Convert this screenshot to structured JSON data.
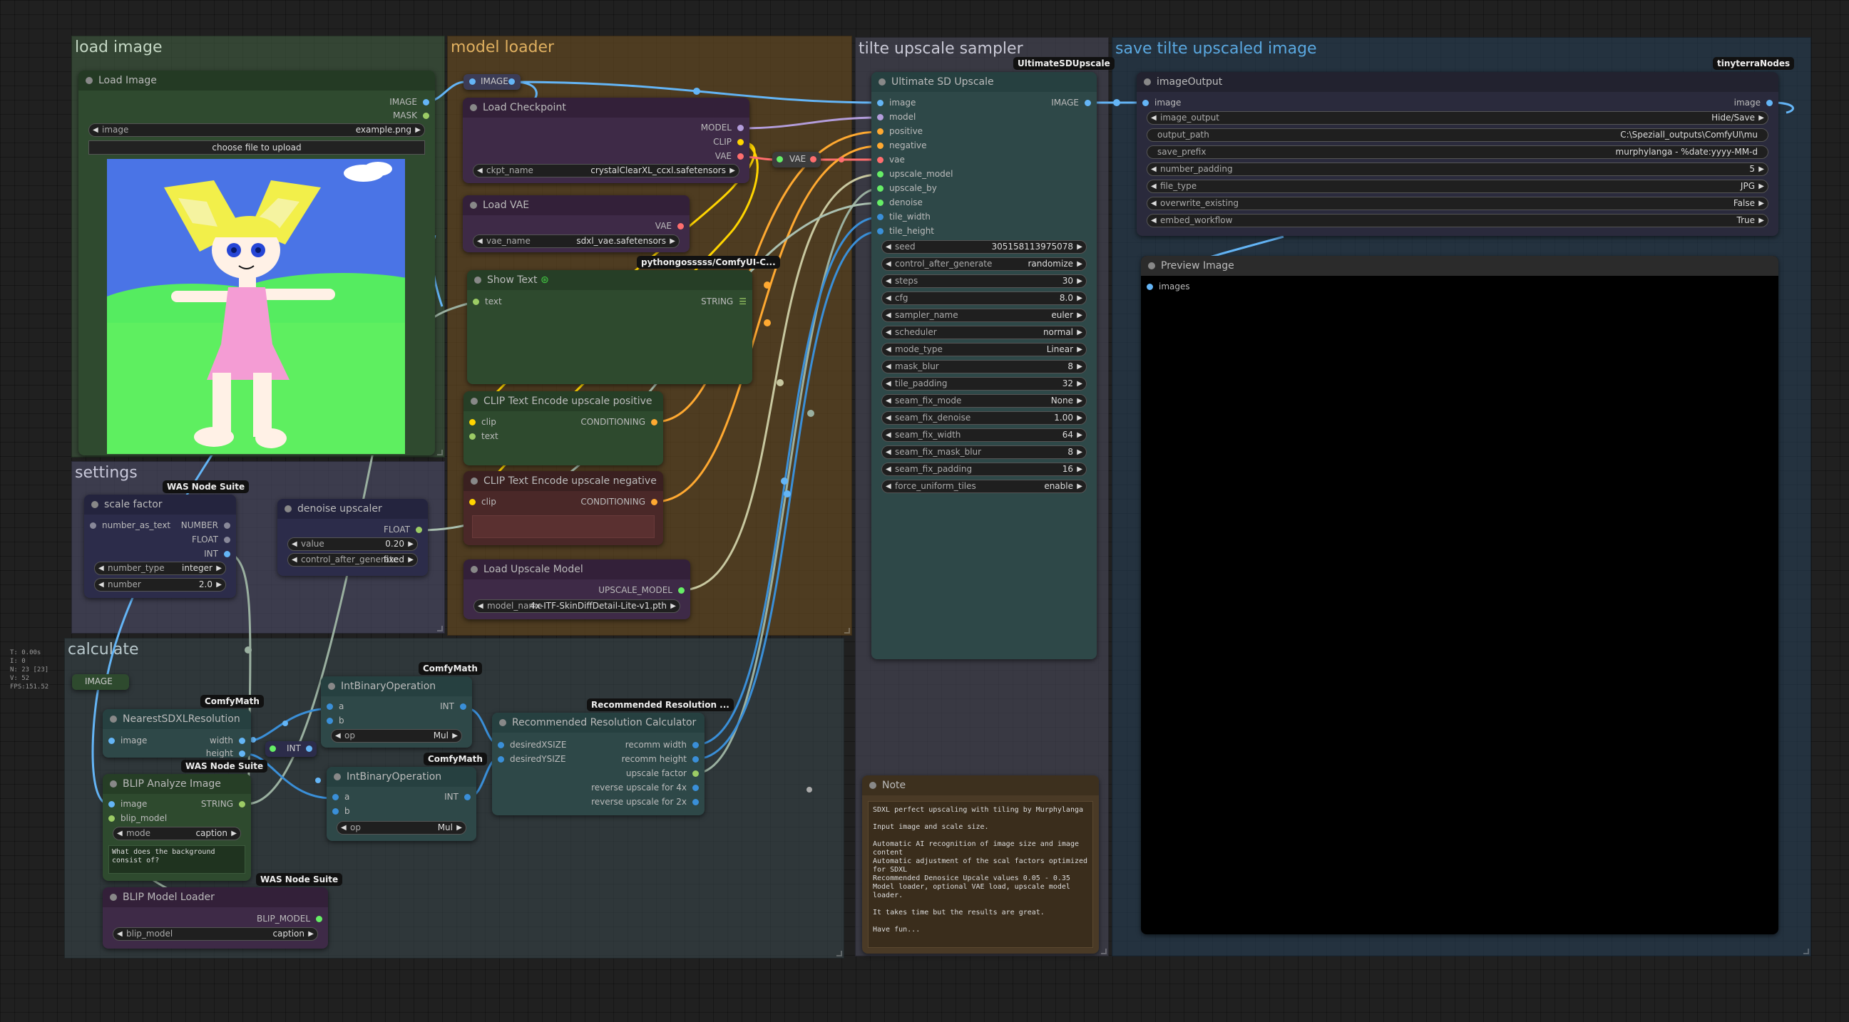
{
  "colors": {
    "accent": "#5ab0f0",
    "image_link": "#64b5f6",
    "model_link": "#b39ddb",
    "clip_link": "#ffd500",
    "vae_link": "#ff6e6e",
    "conditioning_link": "#ffa931",
    "upscale_model_link": "#c8c8a0"
  },
  "groups": {
    "load_image": "load image",
    "model_loader": "model loader",
    "tilte_upscale_sampler": "tilte upscale sampler",
    "save_tilte": "save tilte upscaled image",
    "settings": "settings",
    "calculate": "calculate"
  },
  "stats": {
    "t": "T: 0.00s",
    "i": "I: 0",
    "n": "N: 23 [23]",
    "v": "V: 52",
    "fps": "FPS:151.52"
  },
  "load_image": {
    "title": "Load Image",
    "out_image": "IMAGE",
    "out_mask": "MASK",
    "image_label": "image",
    "image_value": "example.png",
    "upload": "choose file to upload"
  },
  "reroute_image": {
    "label": "IMAGE"
  },
  "reroute_vae": {
    "label": "VAE"
  },
  "checkpoint": {
    "title": "Load Checkpoint",
    "out_model": "MODEL",
    "out_clip": "CLIP",
    "out_vae": "VAE",
    "ckpt_label": "ckpt_name",
    "ckpt_value": "crystalClearXL_ccxl.safetensors"
  },
  "load_vae": {
    "title": "Load VAE",
    "out_vae": "VAE",
    "vae_label": "vae_name",
    "vae_value": "sdxl_vae.safetensors"
  },
  "show_text": {
    "badge": "pythongosssss/ComfyUI-C...",
    "title": "Show Text",
    "in_text": "text",
    "out_string": "STRING"
  },
  "clip_pos": {
    "title": "CLIP Text Encode upscale positive",
    "in_clip": "clip",
    "in_text": "text",
    "out": "CONDITIONING"
  },
  "clip_neg": {
    "title": "CLIP Text Encode upscale negative",
    "in_clip": "clip",
    "out": "CONDITIONING"
  },
  "upscale_model": {
    "title": "Load Upscale Model",
    "out": "UPSCALE_MODEL",
    "model_label": "model_name",
    "model_value": "4x-ITF-SkinDiffDetail-Lite-v1.pth"
  },
  "usd": {
    "badge": "UltimateSDUpscale",
    "title": "Ultimate SD Upscale",
    "out": "IMAGE",
    "inputs": [
      "image",
      "model",
      "positive",
      "negative",
      "vae",
      "upscale_model",
      "upscale_by",
      "denoise",
      "tile_width",
      "tile_height"
    ],
    "widgets": [
      {
        "k": "seed",
        "v": "305158113975078"
      },
      {
        "k": "control_after_generate",
        "v": "randomize"
      },
      {
        "k": "steps",
        "v": "30"
      },
      {
        "k": "cfg",
        "v": "8.0"
      },
      {
        "k": "sampler_name",
        "v": "euler"
      },
      {
        "k": "scheduler",
        "v": "normal"
      },
      {
        "k": "mode_type",
        "v": "Linear"
      },
      {
        "k": "mask_blur",
        "v": "8"
      },
      {
        "k": "tile_padding",
        "v": "32"
      },
      {
        "k": "seam_fix_mode",
        "v": "None"
      },
      {
        "k": "seam_fix_denoise",
        "v": "1.00"
      },
      {
        "k": "seam_fix_width",
        "v": "64"
      },
      {
        "k": "seam_fix_mask_blur",
        "v": "8"
      },
      {
        "k": "seam_fix_padding",
        "v": "16"
      },
      {
        "k": "force_uniform_tiles",
        "v": "enable"
      }
    ]
  },
  "image_output": {
    "badge": "tinyterraNodes",
    "title": "imageOutput",
    "in_image": "image",
    "out_image": "image",
    "widgets": [
      {
        "k": "image_output",
        "v": "Hide/Save"
      },
      {
        "k": "output_path",
        "v": "C:\\Speziall_outputs\\ComfyUI\\mu"
      },
      {
        "k": "save_prefix",
        "v": "murphylanga - %date:yyyy-MM-d"
      },
      {
        "k": "number_padding",
        "v": "5"
      },
      {
        "k": "file_type",
        "v": "JPG"
      },
      {
        "k": "overwrite_existing",
        "v": "False"
      },
      {
        "k": "embed_workflow",
        "v": "True"
      }
    ]
  },
  "preview": {
    "title": "Preview Image",
    "in_images": "images"
  },
  "scale_factor": {
    "badge": "WAS Node Suite",
    "title": "scale factor",
    "in_text": "number_as_text",
    "out_number": "NUMBER",
    "out_float": "FLOAT",
    "out_int": "INT",
    "type_label": "number_type",
    "type_value": "integer",
    "num_label": "number",
    "num_value": "2.0"
  },
  "denoise": {
    "title": "denoise upscaler",
    "out": "FLOAT",
    "value_label": "value",
    "value": "0.20",
    "cag_label": "control_after_generate",
    "cag_value": "fixed"
  },
  "nearest": {
    "badge": "ComfyMath",
    "title": "NearestSDXLResolution",
    "in_image": "image",
    "out_width": "width",
    "out_height": "height"
  },
  "reroute_int": {
    "label": "INT"
  },
  "blip": {
    "badge": "WAS Node Suite",
    "title": "BLIP Analyze Image",
    "in_image": "image",
    "in_model": "blip_model",
    "out": "STRING",
    "mode_label": "mode",
    "mode_value": "caption",
    "question": "What does the background consist of?"
  },
  "blip_loader": {
    "badge": "WAS Node Suite",
    "title": "BLIP Model Loader",
    "out": "BLIP_MODEL",
    "label": "blip_model",
    "value": "caption"
  },
  "intbin1": {
    "badge": "ComfyMath",
    "title": "IntBinaryOperation",
    "in_a": "a",
    "in_b": "b",
    "out": "INT",
    "op_label": "op",
    "op_value": "Mul"
  },
  "intbin2": {
    "badge": "ComfyMath",
    "title": "IntBinaryOperation",
    "in_a": "a",
    "in_b": "b",
    "out": "INT",
    "op_label": "op",
    "op_value": "Mul"
  },
  "recres": {
    "badge": "Recommended Resolution ...",
    "title": "Recommended Resolution Calculator",
    "in_x": "desiredXSIZE",
    "in_y": "desiredYSIZE",
    "outs": [
      "recomm width",
      "recomm height",
      "upscale factor",
      "reverse upscale for 4x",
      "reverse upscale for 2x"
    ]
  },
  "note": {
    "title": "Note",
    "lines": [
      "SDXL perfect upscaling with tiling by Murphylanga",
      "",
      "Input image and scale size.",
      "",
      "Automatic AI recognition of image size and image content",
      "Automatic adjustment of the scal factors optimized for SDXL",
      "Recommended Denosice Upcale values 0.05 - 0.35",
      "Model loader, optional VAE load, upscale model loader.",
      "",
      "It takes time but the results are great.",
      "",
      "Have fun..."
    ]
  }
}
